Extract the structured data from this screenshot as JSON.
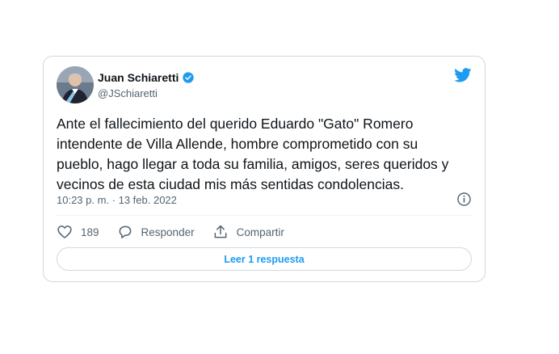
{
  "tweet": {
    "author_name": "Juan Schiaretti",
    "author_handle": "@JSchiaretti",
    "text": "Ante el fallecimiento del querido Eduardo \"Gato\" Romero intendente de Villa Allende, hombre comprometido con su pueblo, hago llegar a toda su familia, amigos, seres queridos y vecinos de esta ciudad mis más sentidas condolencias.",
    "timestamp": "10:23 p. m. · 13 feb. 2022",
    "likes": "189",
    "reply_label": "Responder",
    "share_label": "Compartir",
    "read_replies_label": "Leer 1 respuesta"
  },
  "colors": {
    "accent": "#1d9bf0",
    "muted": "#536471",
    "border": "#cfd9de"
  },
  "icons": [
    "verified-icon",
    "twitter-bird-icon",
    "info-icon",
    "heart-icon",
    "reply-icon",
    "share-icon"
  ]
}
